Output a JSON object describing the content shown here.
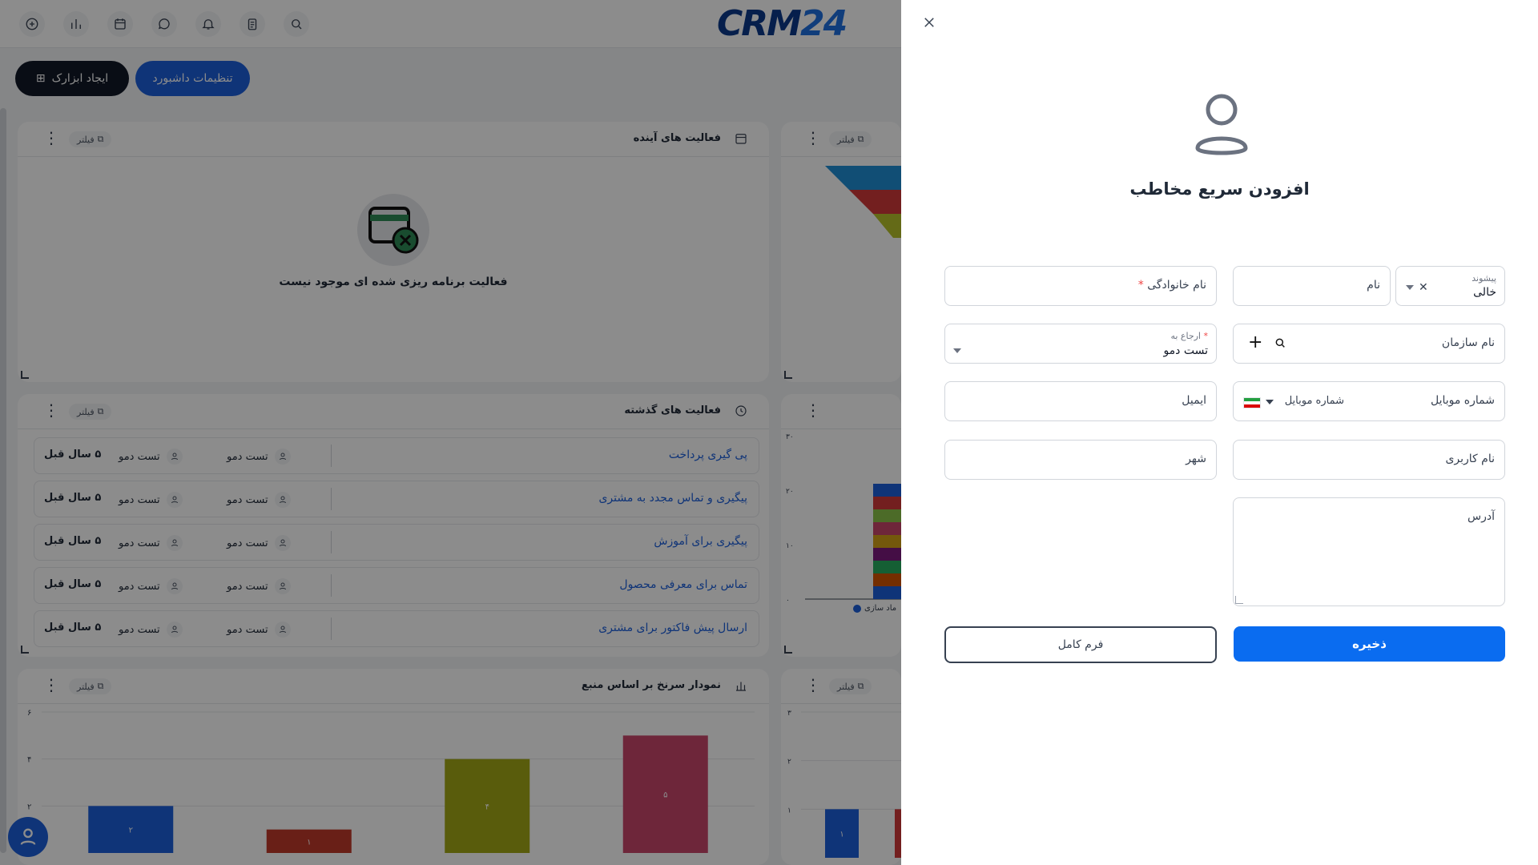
{
  "header": {
    "logo_text": "CRM",
    "logo_number": "24"
  },
  "toolbar": {
    "create_widget": "ایجاد ابزارک",
    "dashboard_settings": "تنظیمات داشبورد"
  },
  "widgets": {
    "filter_label": "فیلتر",
    "upcoming": {
      "title": "فعالیت های آینده",
      "empty_text": "فعالیت برنامه ریزی شده ای موجود نیست"
    },
    "past": {
      "title": "فعالیت های گذشته",
      "rows": [
        {
          "title": "پی گیری پرداخت",
          "user1": "تست دمو",
          "user2": "تست دمو",
          "time": "۵ سال قبل"
        },
        {
          "title": "پیگیری و تماس مجدد به مشتری",
          "user1": "تست دمو",
          "user2": "تست دمو",
          "time": "۵ سال قبل"
        },
        {
          "title": "پیگیری برای آموزش",
          "user1": "تست دمو",
          "user2": "تست دمو",
          "time": "۵ سال قبل"
        },
        {
          "title": "تماس برای معرفی محصول",
          "user1": "تست دمو",
          "user2": "تست دمو",
          "time": "۵ سال قبل"
        },
        {
          "title": "ارسال پیش فاکتور برای مشتری",
          "user1": "تست دمو",
          "user2": "تست دمو",
          "time": "۵ سال قبل"
        }
      ]
    },
    "source_chart": {
      "title": "نمودار سرنخ بر اساس منبع"
    },
    "side_legend": "ماد سازی"
  },
  "chart_data": [
    {
      "type": "bar",
      "title": "نمودار سرنخ بر اساس منبع",
      "categories": [
        "",
        "",
        "",
        ""
      ],
      "values": [
        2,
        1,
        4,
        5
      ],
      "colors": [
        "#1d5fdb",
        "#c0392b",
        "#a3a817",
        "#c8456a"
      ],
      "ylim": [
        0,
        6
      ],
      "yticks": [
        "۲",
        "۴",
        "۶"
      ],
      "value_labels": [
        "۲",
        "۱",
        "۴",
        "۵"
      ]
    },
    {
      "type": "bar",
      "title": "",
      "yticks": [
        "۰",
        "۱۰",
        "۲۰",
        "۳۰"
      ],
      "ylim": [
        0,
        30
      ]
    },
    {
      "type": "bar",
      "title": "",
      "yticks": [
        "۱",
        "۲",
        "۳"
      ],
      "value_labels": [
        "۱"
      ],
      "ylim": [
        0,
        3
      ]
    }
  ],
  "drawer": {
    "title": "افزودن سریع مخاطب",
    "fields": {
      "prefix_label": "پیشوند",
      "prefix_value": "خالی",
      "first_name": "نام",
      "last_name": "نام خانوادگی",
      "required_mark": "*",
      "organization": "نام سازمان",
      "assign_label": "ارجاع به",
      "assign_value": "تست دمو",
      "mobile": "شماره موبایل",
      "mobile_placeholder": "شماره موبایل",
      "email": "ایمیل",
      "username": "نام کاربری",
      "city": "شهر",
      "address": "آدرس"
    },
    "save": "ذخیره",
    "full_form": "فرم کامل"
  },
  "colors": {
    "primary": "#0a6cf0",
    "dark_button": "#111827",
    "required": "#ef4444"
  }
}
